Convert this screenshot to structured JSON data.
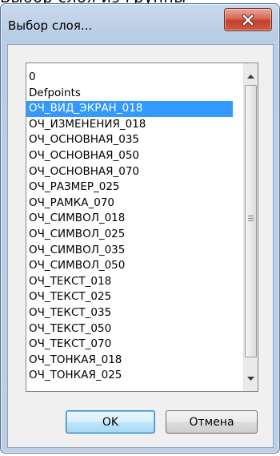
{
  "background": {
    "text": "Выбор слоя из группы"
  },
  "window": {
    "title": "Выбор слоя...",
    "close_icon": "close-x-icon"
  },
  "layers": {
    "items": [
      "0",
      "Defpoints",
      "ОЧ_ВИД_ЭКРАН_018",
      "ОЧ_ИЗМЕНЕНИЯ_018",
      "ОЧ_ОСНОВНАЯ_035",
      "ОЧ_ОСНОВНАЯ_050",
      "ОЧ_ОСНОВНАЯ_070",
      "ОЧ_РАЗМЕР_025",
      "ОЧ_РАМКА_070",
      "ОЧ_СИМВОЛ_018",
      "ОЧ_СИМВОЛ_025",
      "ОЧ_СИМВОЛ_035",
      "ОЧ_СИМВОЛ_050",
      "ОЧ_ТЕКСТ_018",
      "ОЧ_ТЕКСТ_025",
      "ОЧ_ТЕКСТ_035",
      "ОЧ_ТЕКСТ_050",
      "ОЧ_ТЕКСТ_070",
      "ОЧ_ТОНКАЯ_018",
      "ОЧ_ТОНКАЯ_025"
    ],
    "selected_index": 2,
    "selection_color": "#3399ff"
  },
  "buttons": {
    "ok_label": "OK",
    "cancel_label": "Отмена"
  }
}
